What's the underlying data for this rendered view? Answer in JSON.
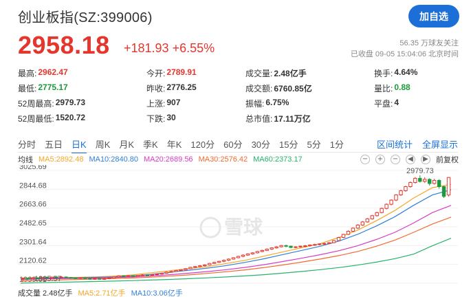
{
  "header": {
    "title": "创业板指(SZ:399006)",
    "follow_button": "加自选",
    "price": "2958.18",
    "change": "+181.93 +6.55%",
    "followers": "56.35 万球友关注",
    "status": "已收盘 09-05 15:04:06 北京时间"
  },
  "quote": [
    [
      {
        "label": "最高:",
        "value": "2962.47",
        "color": "red"
      },
      {
        "label": "今开:",
        "value": "2789.91",
        "color": "red"
      },
      {
        "label": "成交量:",
        "value": "2.48亿手",
        "color": ""
      },
      {
        "label": "换手:",
        "value": "4.64%",
        "color": ""
      }
    ],
    [
      {
        "label": "最低:",
        "value": "2775.17",
        "color": "green"
      },
      {
        "label": "昨收:",
        "value": "2776.25",
        "color": ""
      },
      {
        "label": "成交额:",
        "value": "6760.85亿",
        "color": ""
      },
      {
        "label": "量比:",
        "value": "0.88",
        "color": "green"
      }
    ],
    [
      {
        "label": "52周最高:",
        "value": "2979.73",
        "color": ""
      },
      {
        "label": "上涨:",
        "value": "907",
        "color": ""
      },
      {
        "label": "振幅:",
        "value": "6.75%",
        "color": ""
      },
      {
        "label": "平盘:",
        "value": "4",
        "color": ""
      }
    ],
    [
      {
        "label": "52周最低:",
        "value": "1520.72",
        "color": ""
      },
      {
        "label": "下跌:",
        "value": "30",
        "color": ""
      },
      {
        "label": "总市值:",
        "value": "17.11万亿",
        "color": ""
      },
      {
        "label": "",
        "value": "",
        "color": ""
      }
    ]
  ],
  "tabs": [
    "分时",
    "五日",
    "日K",
    "周K",
    "月K",
    "季K",
    "年K",
    "120分",
    "60分",
    "30分",
    "15分",
    "5分",
    "1分"
  ],
  "active_tab": "日K",
  "tab_links": [
    "区间统计",
    "全屏显示"
  ],
  "ma": {
    "label": "均线",
    "items": [
      {
        "text": "MA5:2892.48",
        "color": "#f5a623"
      },
      {
        "text": "MA10:2840.80",
        "color": "#2f7fd8"
      },
      {
        "text": "MA20:2689.56",
        "color": "#d63cc4"
      },
      {
        "text": "MA30:2576.42",
        "color": "#f26a2e"
      },
      {
        "text": "MA60:2373.17",
        "color": "#25b36b"
      }
    ],
    "tools": [
      "−",
      "+",
      "−",
      "◀",
      "▶"
    ],
    "adjust": "前复权"
  },
  "volume": {
    "label": "成交量 2.48亿手",
    "ma5": "MA5:2.71亿手",
    "ma10": "MA10:3.06亿手"
  },
  "chart_data": {
    "type": "candlestick",
    "y_ticks": [
      "3025.69",
      "2844.68",
      "2663.66",
      "2482.65",
      "2301.64",
      "2120.62",
      "1939.61"
    ],
    "ylim": [
      1939.61,
      3025.69
    ],
    "annotations": {
      "high": "2979.73",
      "low": "1985.57"
    },
    "watermark": "雪球",
    "candles": [
      [
        1980,
        1985,
        1960,
        1992
      ],
      [
        1985,
        1982,
        1972,
        1990
      ],
      [
        1982,
        1990,
        1976,
        1996
      ],
      [
        1990,
        1986,
        1978,
        1994
      ],
      [
        1986,
        1995,
        1980,
        2000
      ],
      [
        1995,
        1990,
        1984,
        2000
      ],
      [
        1990,
        1998,
        1984,
        2004
      ],
      [
        1998,
        1993,
        1988,
        2004
      ],
      [
        1993,
        1999,
        1988,
        2006
      ],
      [
        1999,
        1994,
        1990,
        2005
      ],
      [
        1994,
        1990,
        1985,
        1998
      ],
      [
        1990,
        1986,
        1982,
        1995
      ],
      [
        1986,
        1991,
        1980,
        1996
      ],
      [
        1991,
        1985,
        1981,
        1996
      ],
      [
        1985,
        1980,
        1972,
        1990
      ],
      [
        1980,
        1984,
        1974,
        1990
      ],
      [
        1984,
        1979,
        1975,
        1988
      ],
      [
        1979,
        1983,
        1973,
        1989
      ],
      [
        1983,
        1990,
        1978,
        1996
      ],
      [
        1990,
        2000,
        1986,
        2005
      ],
      [
        2000,
        2010,
        1995,
        2016
      ],
      [
        2010,
        2005,
        2000,
        2014
      ],
      [
        2005,
        2012,
        2000,
        2016
      ],
      [
        2012,
        2006,
        2002,
        2016
      ],
      [
        2006,
        2015,
        2001,
        2018
      ],
      [
        2015,
        2020,
        2008,
        2026
      ],
      [
        2020,
        2015,
        2010,
        2025
      ],
      [
        2015,
        2022,
        2010,
        2028
      ],
      [
        2022,
        2028,
        2016,
        2034
      ],
      [
        2028,
        2036,
        2022,
        2040
      ],
      [
        2036,
        2046,
        2030,
        2052
      ],
      [
        2046,
        2052,
        2040,
        2058
      ],
      [
        2052,
        2062,
        2048,
        2068
      ],
      [
        2062,
        2070,
        2055,
        2075
      ],
      [
        2070,
        2080,
        2064,
        2086
      ],
      [
        2080,
        2092,
        2076,
        2098
      ],
      [
        2092,
        2100,
        2086,
        2106
      ],
      [
        2100,
        2108,
        2094,
        2114
      ],
      [
        2108,
        2116,
        2100,
        2122
      ],
      [
        2116,
        2130,
        2110,
        2136
      ],
      [
        2130,
        2140,
        2124,
        2146
      ],
      [
        2140,
        2150,
        2134,
        2156
      ],
      [
        2150,
        2160,
        2142,
        2168
      ],
      [
        2160,
        2172,
        2152,
        2178
      ],
      [
        2172,
        2185,
        2166,
        2190
      ],
      [
        2185,
        2198,
        2180,
        2204
      ],
      [
        2198,
        2210,
        2190,
        2218
      ],
      [
        2210,
        2222,
        2204,
        2228
      ],
      [
        2222,
        2232,
        2214,
        2238
      ],
      [
        2232,
        2245,
        2226,
        2252
      ],
      [
        2245,
        2255,
        2238,
        2262
      ],
      [
        2255,
        2268,
        2250,
        2274
      ],
      [
        2268,
        2280,
        2260,
        2286
      ],
      [
        2280,
        2290,
        2272,
        2298
      ],
      [
        2290,
        2302,
        2284,
        2308
      ],
      [
        2302,
        2296,
        2286,
        2310
      ],
      [
        2296,
        2284,
        2276,
        2302
      ],
      [
        2284,
        2290,
        2278,
        2296
      ],
      [
        2290,
        2296,
        2282,
        2302
      ],
      [
        2296,
        2300,
        2288,
        2308
      ],
      [
        2300,
        2308,
        2292,
        2314
      ],
      [
        2308,
        2312,
        2300,
        2320
      ],
      [
        2312,
        2318,
        2304,
        2324
      ],
      [
        2318,
        2322,
        2310,
        2330
      ],
      [
        2322,
        2330,
        2314,
        2336
      ],
      [
        2330,
        2350,
        2324,
        2356
      ],
      [
        2350,
        2380,
        2344,
        2386
      ],
      [
        2380,
        2410,
        2374,
        2416
      ],
      [
        2410,
        2440,
        2404,
        2448
      ],
      [
        2440,
        2470,
        2432,
        2478
      ],
      [
        2470,
        2500,
        2462,
        2508
      ],
      [
        2500,
        2530,
        2492,
        2538
      ],
      [
        2530,
        2560,
        2522,
        2568
      ],
      [
        2560,
        2590,
        2552,
        2598
      ],
      [
        2590,
        2620,
        2582,
        2628
      ],
      [
        2620,
        2660,
        2612,
        2668
      ],
      [
        2660,
        2700,
        2650,
        2708
      ],
      [
        2700,
        2740,
        2690,
        2748
      ],
      [
        2740,
        2790,
        2730,
        2798
      ],
      [
        2790,
        2830,
        2780,
        2840
      ],
      [
        2830,
        2870,
        2820,
        2878
      ],
      [
        2870,
        2910,
        2860,
        2920
      ],
      [
        2910,
        2950,
        2900,
        2962
      ],
      [
        2950,
        2920,
        2910,
        2979
      ],
      [
        2920,
        2940,
        2905,
        2960
      ],
      [
        2940,
        2900,
        2880,
        2950
      ],
      [
        2900,
        2930,
        2890,
        2945
      ],
      [
        2930,
        2870,
        2850,
        2940
      ],
      [
        2870,
        2776,
        2760,
        2880
      ],
      [
        2789,
        2958,
        2775,
        2962
      ]
    ],
    "ma_series": [
      {
        "name": "MA5",
        "color": "#f5a623",
        "values": [
          1990,
          1992,
          1994,
          1996,
          2000,
          2008,
          2020,
          2040,
          2060,
          2080,
          2100,
          2130,
          2160,
          2200,
          2240,
          2280,
          2320,
          2380,
          2450,
          2540,
          2640,
          2760,
          2860,
          2892
        ]
      },
      {
        "name": "MA10",
        "color": "#2f7fd8",
        "values": [
          1985,
          1988,
          1990,
          1992,
          1995,
          2000,
          2010,
          2025,
          2045,
          2065,
          2085,
          2110,
          2140,
          2175,
          2215,
          2255,
          2295,
          2345,
          2410,
          2490,
          2580,
          2690,
          2790,
          2840
        ]
      },
      {
        "name": "MA20",
        "color": "#d63cc4",
        "values": [
          1975,
          1980,
          1983,
          1986,
          1990,
          1994,
          2000,
          2010,
          2022,
          2036,
          2052,
          2070,
          2092,
          2118,
          2148,
          2180,
          2214,
          2252,
          2300,
          2360,
          2430,
          2520,
          2620,
          2689
        ]
      },
      {
        "name": "MA30",
        "color": "#f26a2e",
        "values": [
          1960,
          1965,
          1970,
          1975,
          1980,
          1985,
          1990,
          1998,
          2008,
          2020,
          2034,
          2050,
          2068,
          2090,
          2115,
          2142,
          2172,
          2205,
          2245,
          2295,
          2355,
          2430,
          2510,
          2576
        ]
      },
      {
        "name": "MA60",
        "color": "#25b36b",
        "values": [
          1940,
          1944,
          1948,
          1952,
          1956,
          1960,
          1965,
          1970,
          1976,
          1983,
          1991,
          2000,
          2010,
          2022,
          2036,
          2052,
          2070,
          2090,
          2114,
          2142,
          2176,
          2220,
          2300,
          2373
        ]
      }
    ]
  }
}
